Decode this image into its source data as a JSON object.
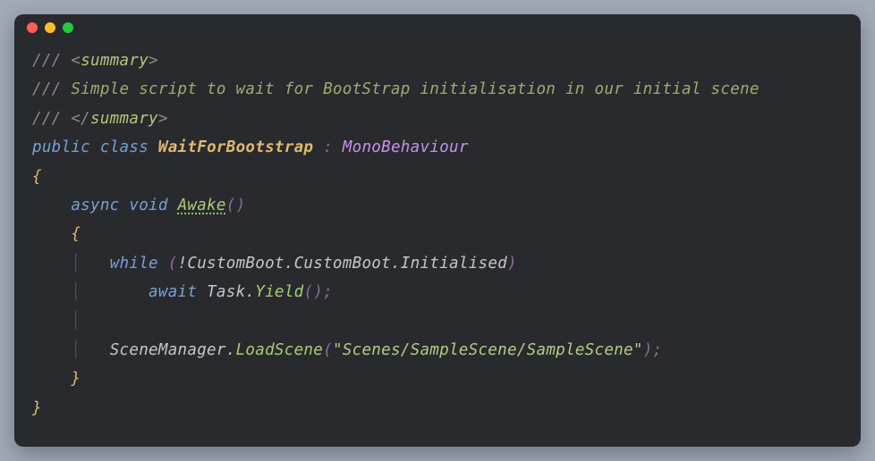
{
  "colors": {
    "background": "#a0abb8",
    "editor_bg": "#282a2e",
    "comment_slash": "#8a8a8a",
    "comment_text": "#97b06c",
    "keyword": "#7aa0d6",
    "classname": "#e0b86f",
    "type": "#c792ea",
    "method": "#a7cf70",
    "string": "#b1cf82"
  },
  "traffic": {
    "red": true,
    "yellow": true,
    "green": true
  },
  "code": {
    "line1": {
      "slash": "/// ",
      "lt": "<",
      "tag": "summary",
      "gt": ">"
    },
    "line2": {
      "slash": "/// ",
      "text": "Simple script to wait for BootStrap initialisation in our initial scene"
    },
    "line3": {
      "slash": "/// ",
      "lt": "</",
      "tag": "summary",
      "gt": ">"
    },
    "line4": {
      "kw_public": "public",
      "kw_class": "class",
      "classname": "WaitForBootstrap",
      "colon": ":",
      "basetype": "MonoBehaviour"
    },
    "line5": {
      "brace": "{"
    },
    "line6": {
      "indent": "    ",
      "kw_async": "async",
      "kw_void": "void",
      "method": "Awake",
      "parens": "()"
    },
    "line7": {
      "indent": "    ",
      "brace": "{"
    },
    "line8": {
      "indent": "        ",
      "kw_while": "while",
      "open": " (",
      "not": "!",
      "ns1": "CustomBoot",
      "dot1": ".",
      "ns2": "CustomBoot",
      "dot2": ".",
      "prop": "Initialised",
      "close": ")"
    },
    "line9": {
      "indent": "            ",
      "kw_await": "await",
      "task": "Task",
      "dot": ".",
      "yield": "Yield",
      "parens": "()",
      "semi": ";"
    },
    "line10": {
      "indent": "        "
    },
    "line11": {
      "indent": "        ",
      "sm": "SceneManager",
      "dot": ".",
      "load": "LoadScene",
      "open": "(",
      "str": "\"Scenes/SampleScene/SampleScene\"",
      "close": ")",
      "semi": ";"
    },
    "line12": {
      "indent": "    ",
      "brace": "}"
    },
    "line13": {
      "brace": "}"
    }
  }
}
